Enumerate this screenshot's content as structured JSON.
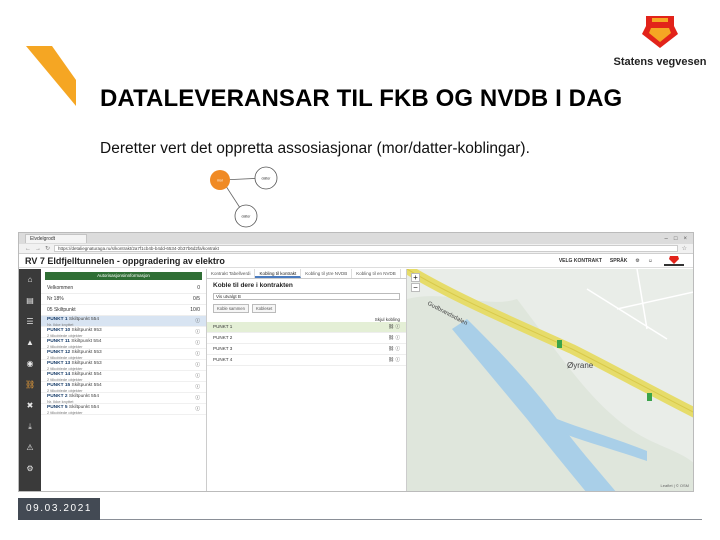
{
  "slide": {
    "brand_name": "Statens vegvesen",
    "title": "DATALEVERANSAR TIL FKB OG NVDB I DAG",
    "body": "Deretter vert det oppretta assosiasjonar (mor/datter-koblingar).",
    "date": "09.03.2021",
    "accent_color": "#f5a623",
    "brand_color": "#e2231a"
  },
  "diagram": {
    "nodes": [
      "mor",
      "datter",
      "datter"
    ],
    "node_color": "#f08a24"
  },
  "browser": {
    "tab_label": "Elvdelgrodt",
    "url": "https://detaliegnaturaga.ru/s/kontrakt/2a7f1cb4b-b4dd-6534-2b37b6d2fa/kontrakt",
    "controls": [
      "–",
      "□",
      "×"
    ]
  },
  "app": {
    "title": "RV 7 Eldfjelltunnelen - oppgradering av elektro",
    "header_buttons": [
      "VELG KONTRAKT",
      "SPRÅK"
    ],
    "list_header": "Autorisasjonsinnformasjon",
    "list_filters": [
      {
        "label": "Velkommen",
        "info": "0"
      },
      {
        "label": "Nr 18%",
        "info": "0/5"
      },
      {
        "label": "05 Skiltpunkt",
        "info": "10/0"
      }
    ],
    "points": [
      {
        "name": "PUNKT 1",
        "desc": "Skiltpunkt 554",
        "sub": "Nr. Ikke knyttet",
        "selected": true
      },
      {
        "name": "PUNKT 10",
        "desc": "Skiltpunkt 953",
        "sub": "2 tilkoblede objekter",
        "selected": false
      },
      {
        "name": "PUNKT 11",
        "desc": "Skiltpunkt 554",
        "sub": "2 tilkoblede objekter",
        "selected": false
      },
      {
        "name": "PUNKT 12",
        "desc": "Skiltpunkt 553",
        "sub": "2 tilkoblede objekter",
        "selected": false
      },
      {
        "name": "PUNKT 13",
        "desc": "Skiltpunkt 553",
        "sub": "2 tilkoblede objekter",
        "selected": false
      },
      {
        "name": "PUNKT 14",
        "desc": "Skiltpunkt 554",
        "sub": "2 tilkoblede objekter",
        "selected": false
      },
      {
        "name": "PUNKT 15",
        "desc": "Skiltpunkt 554",
        "sub": "2 tilkoblede objekter",
        "selected": false
      },
      {
        "name": "PUNKT 2",
        "desc": "Skiltpunkt 554",
        "sub": "Nr. Ikke knyttet",
        "selected": false
      },
      {
        "name": "PUNKT 5",
        "desc": "Skiltpunkt 554",
        "sub": "2 tilkoblede objekter",
        "selected": false
      }
    ],
    "form_tabs": [
      "Kontrakt Tabellverdi",
      "Kobling til kontrakt",
      "Kobling til ytre NVDB",
      "Kobling til en NVDB"
    ],
    "form_title": "Koble til dere i kontrakten",
    "form_select": "Vis utvalgt B",
    "form_buttons": [
      "Koble sammen",
      "Kobleset"
    ],
    "form_col_label": "Skjul kobling",
    "form_points": [
      {
        "name": "PUNKT 1",
        "selected": true
      },
      {
        "name": "PUNKT 2",
        "selected": false
      },
      {
        "name": "PUNKT 3",
        "selected": false
      },
      {
        "name": "PUNKT 4",
        "selected": false
      }
    ],
    "map_labels": [
      "Øyrane",
      "Gudbrandsdalen"
    ],
    "map_attribution": "Leaflet | © OSM"
  }
}
